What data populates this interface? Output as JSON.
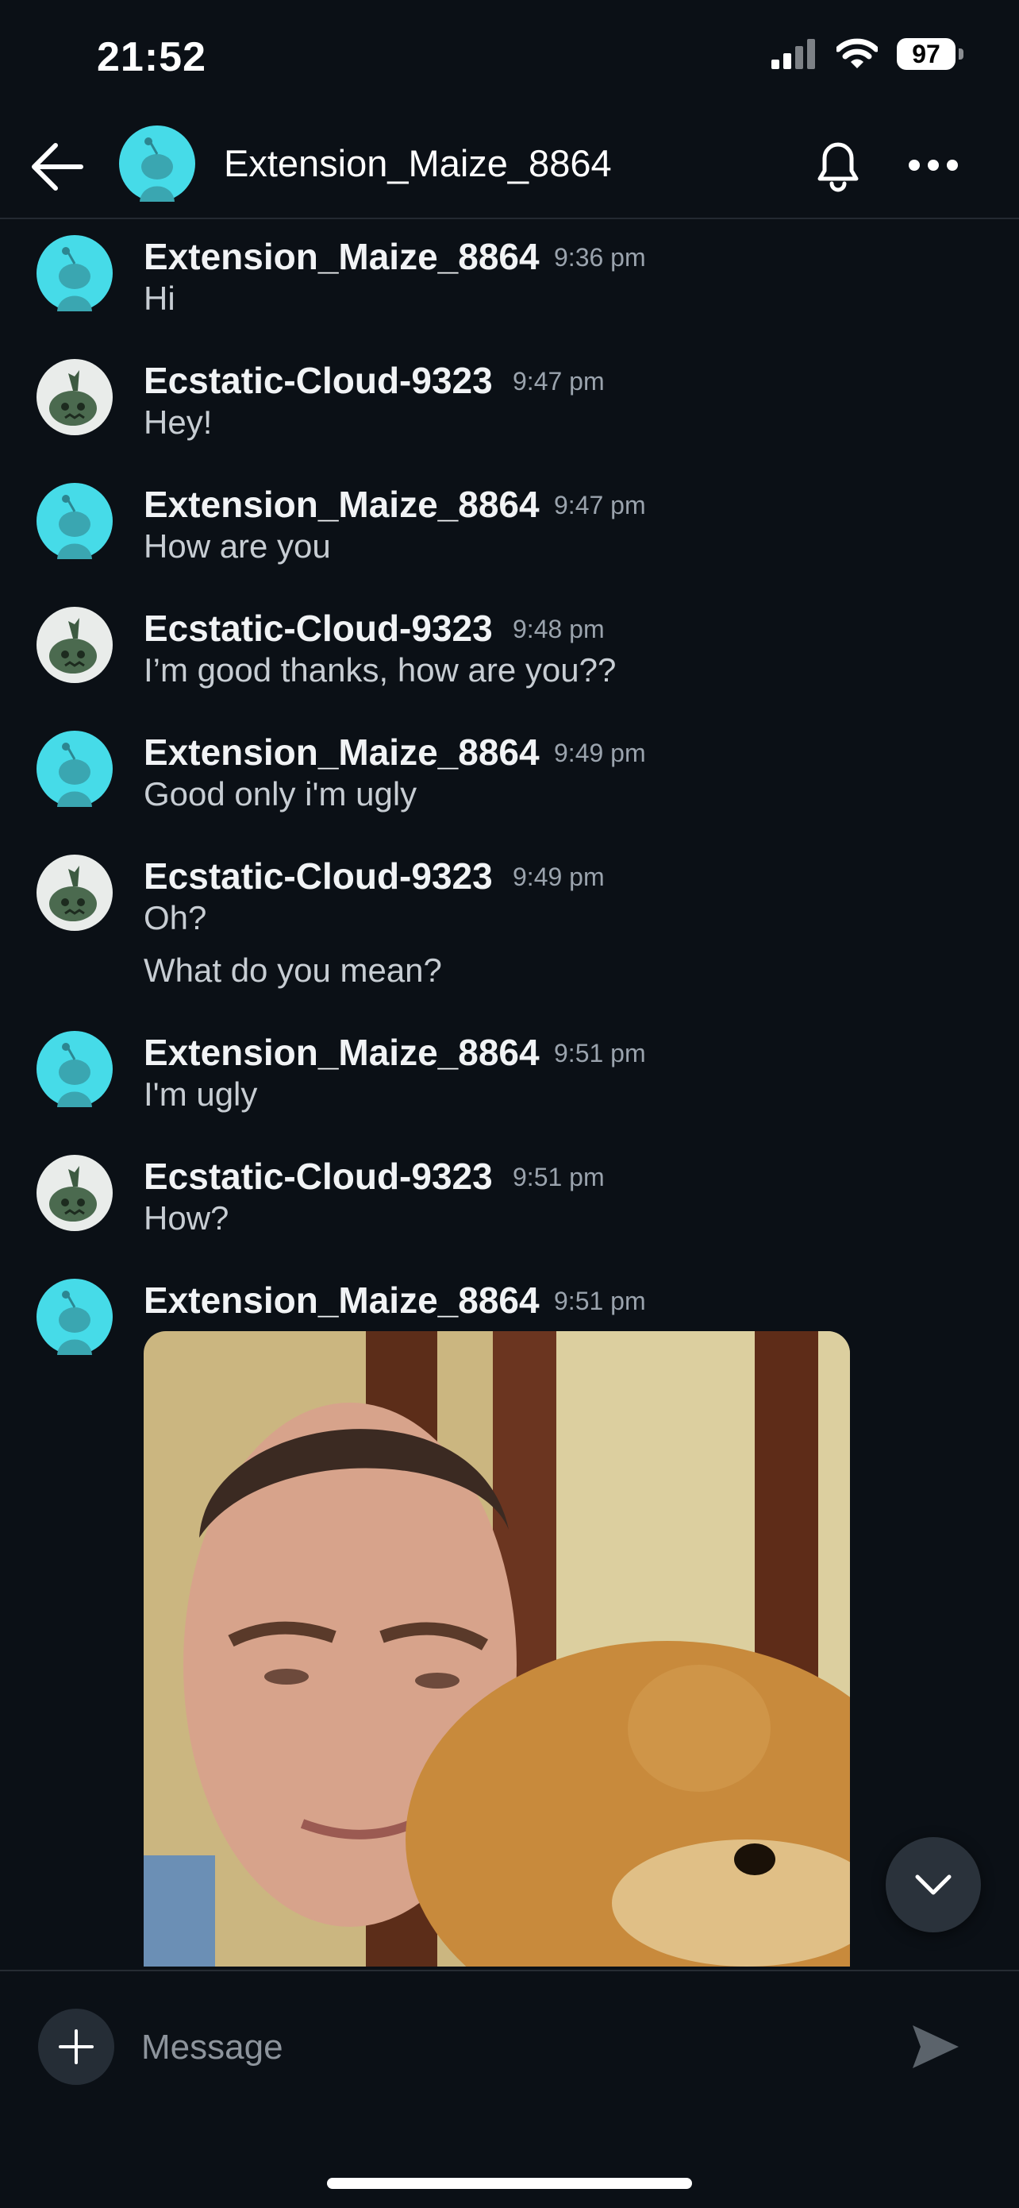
{
  "status": {
    "time": "21:52",
    "battery": "97"
  },
  "header": {
    "title": "Extension_Maize_8864"
  },
  "messages": [
    {
      "user": "Extension_Maize_8864",
      "time": "9:36 pm",
      "text": [
        "Hi"
      ]
    },
    {
      "user": "Ecstatic-Cloud-9323",
      "time": "9:47 pm",
      "text": [
        "Hey!"
      ]
    },
    {
      "user": "Extension_Maize_8864",
      "time": "9:47 pm",
      "text": [
        "How are you"
      ]
    },
    {
      "user": "Ecstatic-Cloud-9323",
      "time": "9:48 pm",
      "text": [
        "I’m good thanks, how are you??"
      ]
    },
    {
      "user": "Extension_Maize_8864",
      "time": "9:49 pm",
      "text": [
        "Good only i'm ugly"
      ]
    },
    {
      "user": "Ecstatic-Cloud-9323",
      "time": "9:49 pm",
      "text": [
        "Oh?",
        "What do you mean?"
      ]
    },
    {
      "user": "Extension_Maize_8864",
      "time": "9:51 pm",
      "text": [
        "I'm ugly"
      ]
    },
    {
      "user": "Ecstatic-Cloud-9323",
      "time": "9:51 pm",
      "text": [
        "How?"
      ]
    },
    {
      "user": "Extension_Maize_8864",
      "time": "9:51 pm",
      "text": []
    }
  ],
  "composer": {
    "placeholder": "Message"
  },
  "colors": {
    "snoo_teal": "#46dbe8",
    "background": "#0b1016",
    "muted_text": "#9aa3ad"
  }
}
